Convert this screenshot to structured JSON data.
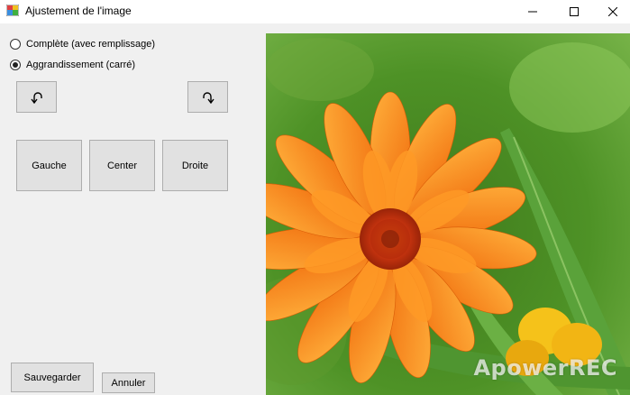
{
  "window": {
    "title": "Ajustement de l'image"
  },
  "options": {
    "full": {
      "label": "Complète (avec remplissage)",
      "checked": false
    },
    "zoom": {
      "label": "Aggrandissement (carré)",
      "checked": true
    }
  },
  "buttons": {
    "left": "Gauche",
    "center": "Center",
    "right": "Droite",
    "save": "Sauvegarder",
    "cancel": "Annuler"
  },
  "preview": {
    "watermark": "ApowerREC"
  },
  "icons": {
    "rotate_left": "rotate-left-icon",
    "rotate_right": "rotate-right-icon"
  },
  "colors": {
    "window_bg": "#f0f0f0",
    "button_bg": "#e1e1e1",
    "button_border": "#adadad",
    "petal": "#f47a14",
    "flower_center": "#c7340f"
  }
}
